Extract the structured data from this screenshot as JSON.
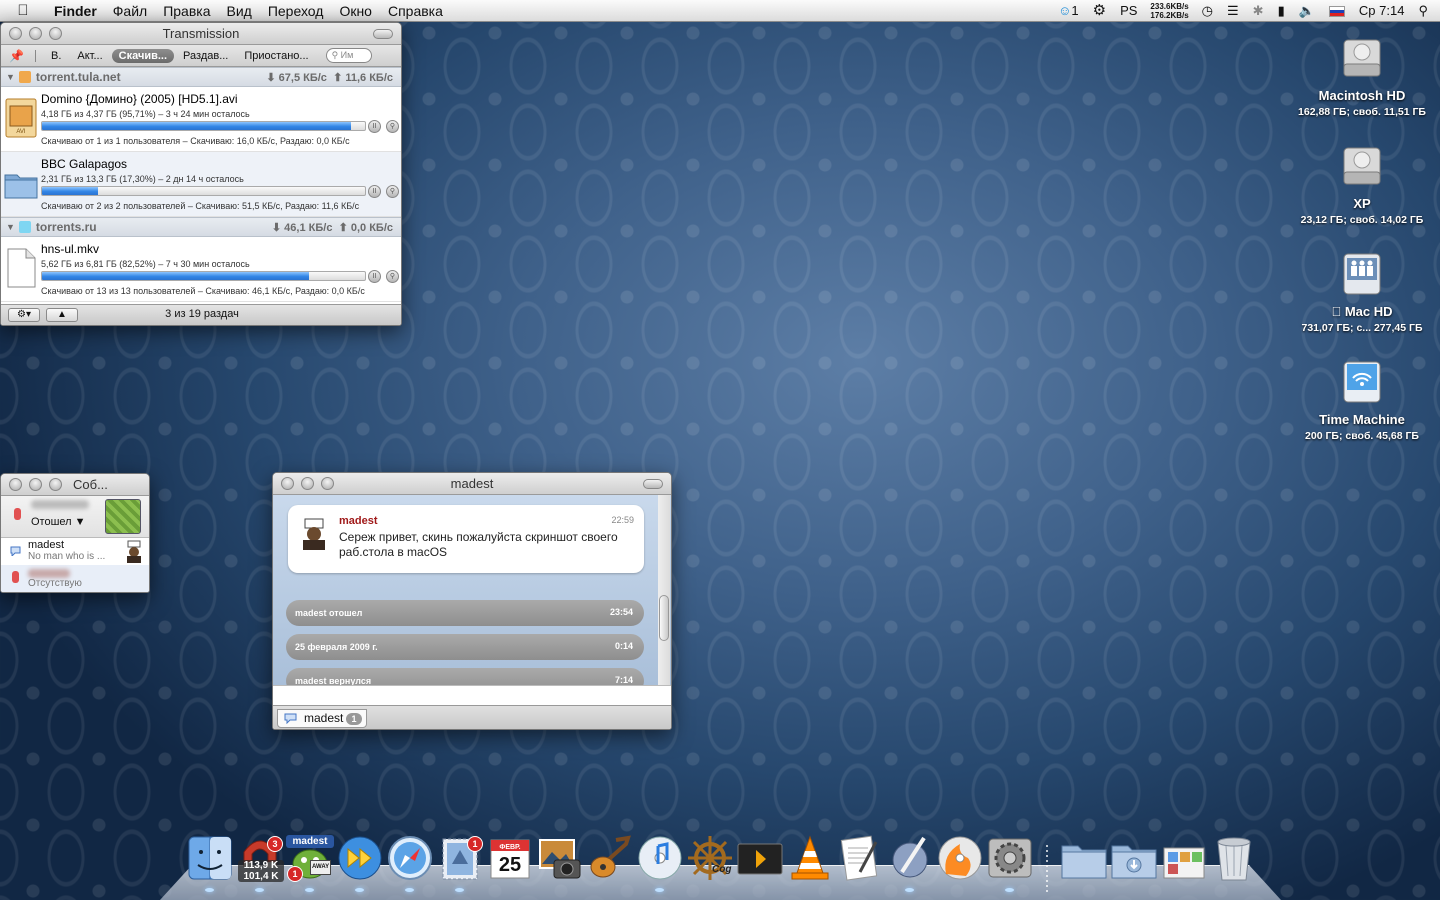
{
  "menubar": {
    "app": "Finder",
    "items": [
      "Файл",
      "Правка",
      "Вид",
      "Переход",
      "Окно",
      "Справка"
    ],
    "status": {
      "skype_count": "1",
      "ps": "PS",
      "net_down": "233.6KB/s",
      "net_up": "176.2KB/s",
      "clock": "Ср 7:14"
    }
  },
  "transmission": {
    "title": "Transmission",
    "filters": [
      "В.",
      "Акт...",
      "Скачив...",
      "Раздав...",
      "Приостано..."
    ],
    "search_placeholder": "Им",
    "groups": [
      {
        "name": "torrent.tula.net",
        "down": "⬇ 67,5 КБ/с",
        "up": "⬆ 11,6 КБ/с",
        "color": "#f0a84c"
      },
      {
        "name": "torrents.ru",
        "down": "⬇ 46,1 КБ/с",
        "up": "⬆ 0,0 КБ/с",
        "color": "#7fd6f2"
      }
    ],
    "torrents": [
      {
        "name": "Domino {Домино} (2005) [HD5.1].avi",
        "progress": "4,18 ГБ из 4,37 ГБ (95,71%) – 3 ч 24 мин осталось",
        "status": "Скачиваю от 1 из 1 пользователя – Скачиваю: 16,0 КБ/с, Раздаю: 0,0 КБ/с",
        "pct": 95.71
      },
      {
        "name": "BBC Galapagos",
        "progress": "2,31 ГБ из 13,3 ГБ (17,30%) – 2 дн 14 ч осталось",
        "status": "Скачиваю от 2 из 2 пользователей – Скачиваю: 51,5 КБ/с, Раздаю: 11,6 КБ/с",
        "pct": 17.3
      },
      {
        "name": "hns-ul.mkv",
        "progress": "5,62 ГБ из 6,81 ГБ (82,52%) – 7 ч 30 мин осталось",
        "status": "Скачиваю от 13 из 13 пользователей – Скачиваю: 46,1 КБ/с, Раздаю: 0,0 КБ/с",
        "pct": 82.52
      }
    ],
    "footer": "3 из 19 раздач"
  },
  "buddylist": {
    "title": "Соб...",
    "my_status": "Отошел ▼",
    "buddies": [
      {
        "name": "madest",
        "status": "No man who is ..."
      },
      {
        "name": "",
        "status": "Отсутствую"
      }
    ]
  },
  "chat": {
    "title": "madest",
    "message": {
      "sender": "madest",
      "time": "22:59",
      "text": "Сереж привет, скинь пожалуйста скриншот своего раб.стола в macOS"
    },
    "events": [
      {
        "text": "madest отошел",
        "time": "23:54"
      },
      {
        "text": "25 февраля 2009 г.",
        "time": "0:14"
      },
      {
        "text": "madest вернулся",
        "time": "7:14"
      }
    ],
    "tab": {
      "label": "madest",
      "count": "1"
    }
  },
  "desktop": [
    {
      "name": "Macintosh HD",
      "detail": "162,88 ГБ; своб. 11,51 ГБ"
    },
    {
      "name": "XP",
      "detail": "23,12 ГБ; своб. 14,02 ГБ"
    },
    {
      "name": "Mac HD",
      "detail": "731,07 ГБ; с... 277,45 ГБ"
    },
    {
      "name": "Time Machine",
      "detail": "200 ГБ; своб. 45,68 ГБ"
    }
  ],
  "dock": {
    "transmission_badge": "3",
    "transmission_down": "113,9 K",
    "transmission_up": "101,4 K",
    "adium_name": "madest",
    "adium_away": "AWAY",
    "adium_badge": "1",
    "mail_badge": "1",
    "ical_month": "ФЕВР.",
    "ical_day": "25",
    "cog_label": "Cog"
  }
}
